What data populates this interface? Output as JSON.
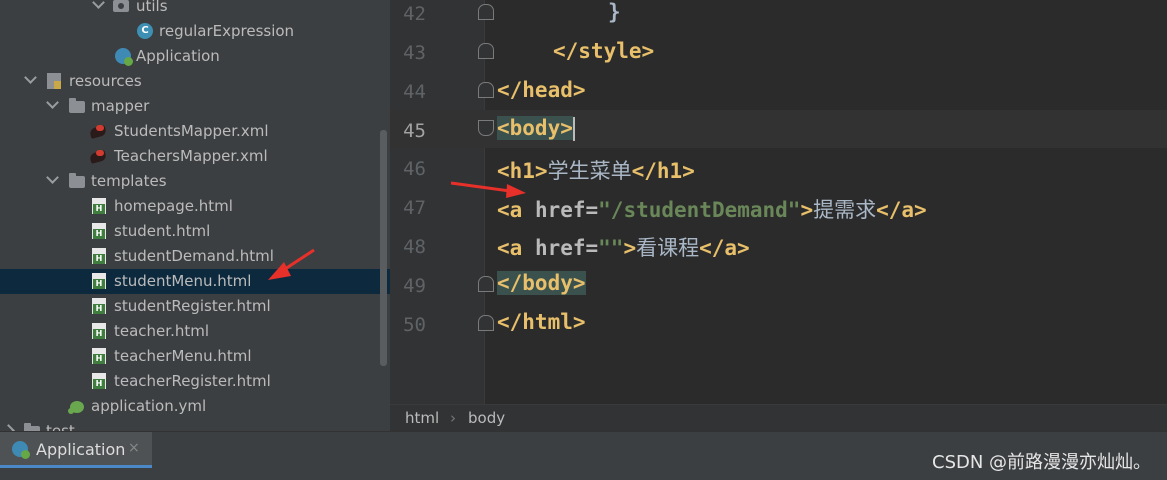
{
  "project_tree": {
    "items": [
      {
        "label": "utils",
        "icon": "package-icon"
      },
      {
        "label": "regularExpression",
        "icon": "class-icon"
      },
      {
        "label": "Application",
        "icon": "spring-app-icon"
      },
      {
        "label": "resources",
        "icon": "resources-folder-icon"
      },
      {
        "label": "mapper",
        "icon": "folder-icon"
      },
      {
        "label": "StudentsMapper.xml",
        "icon": "mybatis-xml-icon"
      },
      {
        "label": "TeachersMapper.xml",
        "icon": "mybatis-xml-icon"
      },
      {
        "label": "templates",
        "icon": "folder-icon"
      },
      {
        "label": "homepage.html",
        "icon": "html-file-icon"
      },
      {
        "label": "student.html",
        "icon": "html-file-icon"
      },
      {
        "label": "studentDemand.html",
        "icon": "html-file-icon"
      },
      {
        "label": "studentMenu.html",
        "icon": "html-file-icon",
        "selected": true
      },
      {
        "label": "studentRegister.html",
        "icon": "html-file-icon"
      },
      {
        "label": "teacher.html",
        "icon": "html-file-icon"
      },
      {
        "label": "teacherMenu.html",
        "icon": "html-file-icon"
      },
      {
        "label": "teacherRegister.html",
        "icon": "html-file-icon"
      },
      {
        "label": "application.yml",
        "icon": "spring-yml-icon"
      },
      {
        "label": "test",
        "icon": "folder-icon"
      }
    ]
  },
  "editor": {
    "lines": [
      {
        "number": "42",
        "code": "}"
      },
      {
        "number": "43",
        "code": "</style>"
      },
      {
        "number": "44",
        "code": "</head>"
      },
      {
        "number": "45",
        "code": "<body>",
        "current": true
      },
      {
        "number": "46",
        "code": "<h1>学生菜单</h1>"
      },
      {
        "number": "47",
        "code": "<a href=\"/studentDemand\">提需求</a>"
      },
      {
        "number": "48",
        "code": "<a href=\"\">看课程</a>"
      },
      {
        "number": "49",
        "code": "</body>"
      },
      {
        "number": "50",
        "code": "</html>"
      }
    ],
    "tokens": {
      "brace": "}",
      "style_close": "</style>",
      "head_close": "</head>",
      "body_open": "<body>",
      "h1_open": "<h1>",
      "h1_text": "学生菜单",
      "h1_close": "</h1>",
      "a_open": "<a ",
      "href_attr": "href=",
      "href_value_1": "\"/studentDemand\"",
      "href_value_2": "\"\"",
      "gt": ">",
      "a1_text": "提需求",
      "a2_text": "看课程",
      "a_close": "</a>",
      "body_close": "</body>",
      "html_close": "</html>"
    }
  },
  "breadcrumb": {
    "items": [
      "html",
      "body"
    ],
    "separator": "›"
  },
  "run_panel": {
    "tab_label": "Application",
    "close_symbol": "×"
  },
  "watermark": "CSDN @前路漫漫亦灿灿。",
  "colors": {
    "tag": "#e8bf6a",
    "string": "#6a8759",
    "arrow": "#e8302a",
    "selection": "#0d293e"
  }
}
